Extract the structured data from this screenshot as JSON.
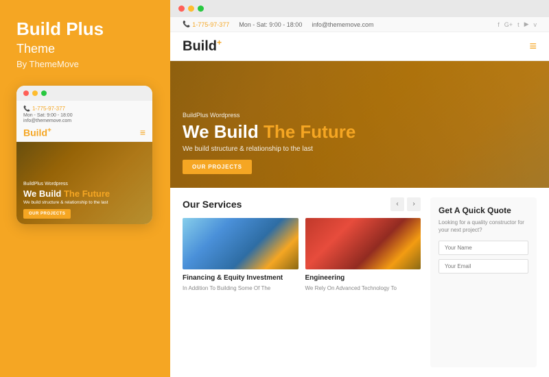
{
  "left": {
    "title": "Build Plus",
    "theme_label": "Theme",
    "by_label": "By ThemeMove",
    "mobile": {
      "phone": "1-775-97-377",
      "hours": "Mon - Sat: 9:00 - 18:00",
      "email": "info@thememove.com",
      "logo": "Build",
      "logo_plus": "+",
      "hero_wp": "BuildPlus Wordpress",
      "hero_title_1": "We Build ",
      "hero_title_2": "The Future",
      "hero_sub": "We build structure & relationship to the last",
      "hero_btn": "OUR PROJECTS"
    }
  },
  "browser": {
    "dots": [
      "red",
      "yellow",
      "green"
    ]
  },
  "site": {
    "topbar": {
      "phone": "1-775-97-377",
      "hours": "Mon - Sat: 9:00 - 18:00",
      "email": "info@thememove.com"
    },
    "nav": {
      "logo": "Build",
      "logo_plus": "+"
    },
    "hero": {
      "wp_label": "BuildPlus Wordpress",
      "title_1": "We Build ",
      "title_2": "The Future",
      "subtitle": "We build structure & relationship to the last",
      "btn": "OUR PROJECTS"
    },
    "services": {
      "title": "Our Services",
      "cards": [
        {
          "title": "Financing & Equity Investment",
          "desc": "In Addition To Building Some Of The"
        },
        {
          "title": "Engineering",
          "desc": "We Rely On Advanced Technology To"
        }
      ],
      "prev_icon": "‹",
      "next_icon": "›"
    },
    "quote": {
      "title": "Get A Quick Quote",
      "desc": "Looking for a quality constructor for your next project?",
      "name_placeholder": "Your Name",
      "email_placeholder": "Your Email"
    }
  }
}
